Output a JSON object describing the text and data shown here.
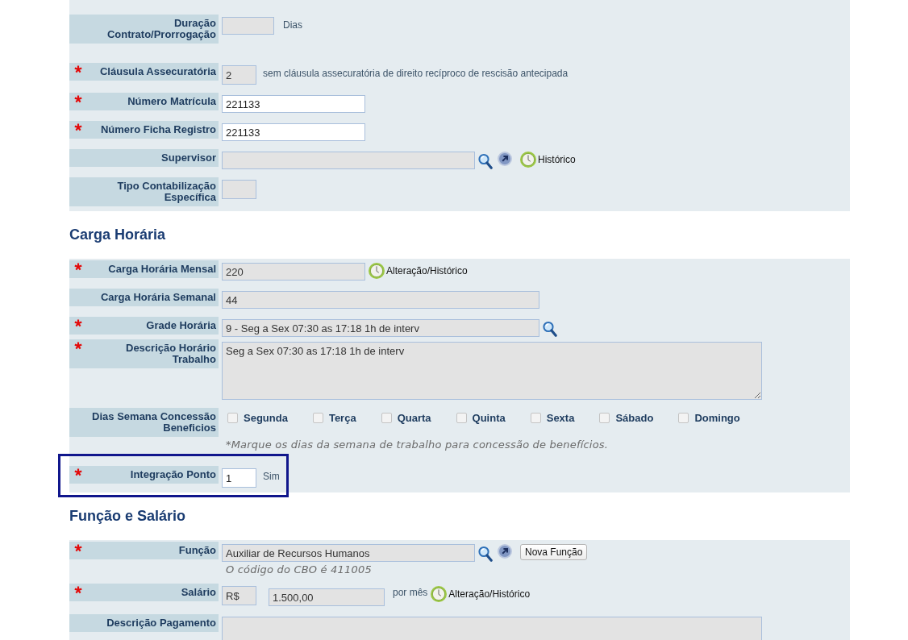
{
  "sections": [
    {
      "rows": [
        {
          "kind": "duration",
          "label": "Duração Contrato/Prorrogação",
          "required": false,
          "highlighted": false,
          "fields": [
            {
              "disabled": true
            }
          ],
          "suffix": "Dias"
        },
        {
          "kind": "code",
          "label": "Cláusula Assecuratória",
          "required": true,
          "highlighted": false,
          "fields": [
            {
              "value": "2",
              "disabled": true
            }
          ],
          "suffix": "sem cláusula assecuratória de direito recíproco de rescisão antecipada"
        },
        {
          "kind": "number",
          "label": "Número Matrícula",
          "required": true,
          "highlighted": false,
          "fields": [
            {
              "value": "221133",
              "disabled": false
            }
          ]
        },
        {
          "kind": "number",
          "label": "Número Ficha Registro",
          "required": true,
          "highlighted": false,
          "fields": [
            {
              "value": "221133",
              "disabled": false
            }
          ]
        },
        {
          "kind": "lookup",
          "label": "Supervisor",
          "required": false,
          "highlighted": false,
          "fields": [
            {
              "disabled": true
            }
          ],
          "actions": [
            {
              "kind": "search"
            },
            {
              "kind": "open"
            },
            {
              "kind": "history",
              "label": "Histórico"
            }
          ]
        },
        {
          "kind": "code",
          "label": "Tipo Contabilização Específica",
          "required": false,
          "highlighted": false,
          "fields": [
            {
              "disabled": true
            }
          ]
        }
      ]
    },
    {
      "heading": "Carga Horária",
      "rows": [
        {
          "kind": "number",
          "label": "Carga Horária Mensal",
          "required": true,
          "highlighted": false,
          "fields": [
            {
              "value": "220",
              "disabled": true
            }
          ],
          "actions": [
            {
              "kind": "history",
              "label": "Alteração/Histórico"
            }
          ]
        },
        {
          "kind": "text",
          "label": "Carga Horária Semanal",
          "required": false,
          "highlighted": false,
          "fields": [
            {
              "value": "44",
              "disabled": true
            }
          ]
        },
        {
          "kind": "text",
          "label": "Grade Horária",
          "required": true,
          "highlighted": false,
          "fields": [
            {
              "value": "9 - Seg a Sex 07:30 as 17:18 1h de interv",
              "disabled": true
            }
          ],
          "actions": [
            {
              "kind": "search"
            }
          ]
        },
        {
          "kind": "textarea",
          "label": "Descrição Horário Trabalho",
          "required": true,
          "highlighted": false,
          "fields": [
            {
              "value": "Seg a Sex 07:30 as 17:18 1h de interv",
              "disabled": true
            }
          ]
        },
        {
          "kind": "weekdays",
          "label": "Dias Semana Concessão Beneficios",
          "required": false,
          "highlighted": false,
          "days": [
            {
              "label": "Segunda",
              "checked": false
            },
            {
              "label": "Terça",
              "checked": false
            },
            {
              "label": "Quarta",
              "checked": false
            },
            {
              "label": "Quinta",
              "checked": false
            },
            {
              "label": "Sexta",
              "checked": false
            },
            {
              "label": "Sábado",
              "checked": false
            },
            {
              "label": "Domingo",
              "checked": false
            }
          ],
          "hint": "*Marque os dias da semana de trabalho para concessão de benefícios."
        },
        {
          "kind": "code",
          "label": "Integração Ponto",
          "required": true,
          "highlighted": true,
          "fields": [
            {
              "value": "1",
              "disabled": false
            }
          ],
          "suffix": "Sim"
        }
      ]
    },
    {
      "heading": "Função e Salário",
      "rows": [
        {
          "kind": "lookup",
          "label": "Função",
          "required": true,
          "highlighted": false,
          "fields": [
            {
              "value": "Auxiliar de Recursos Humanos",
              "disabled": true
            }
          ],
          "actions": [
            {
              "kind": "search"
            },
            {
              "kind": "open"
            },
            {
              "kind": "button",
              "label": "Nova Função"
            }
          ],
          "hint": "O código do CBO é 411005"
        },
        {
          "kind": "money",
          "label": "Salário",
          "required": true,
          "highlighted": false,
          "fields": [
            {
              "value": "R$",
              "disabled": true
            },
            {
              "value": "1.500,00",
              "disabled": true
            }
          ],
          "suffix": "por mês",
          "actions": [
            {
              "kind": "history",
              "label": "Alteração/Histórico"
            }
          ]
        },
        {
          "kind": "textarea",
          "label": "Descrição Pagamento",
          "required": false,
          "highlighted": false,
          "fields": [
            {
              "disabled": true
            }
          ]
        }
      ]
    }
  ]
}
